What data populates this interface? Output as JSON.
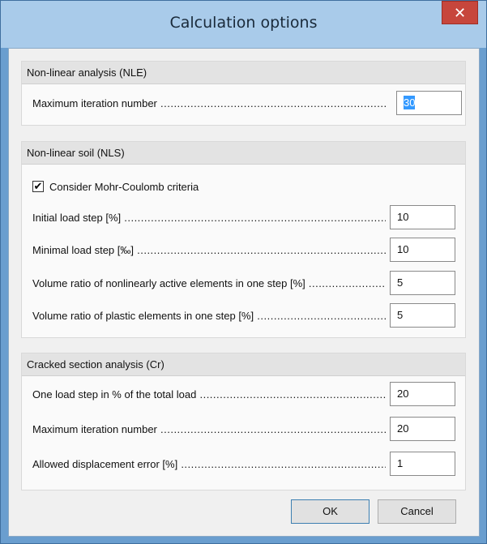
{
  "window": {
    "title": "Calculation options",
    "close_glyph": "✕"
  },
  "nle": {
    "header": "Non-linear analysis (NLE)",
    "rows": [
      {
        "label": "Maximum iteration number",
        "value": "30"
      }
    ]
  },
  "nls": {
    "header": "Non-linear soil (NLS)",
    "checkbox": {
      "label": "Consider Mohr-Coulomb criteria",
      "checked": true,
      "glyph": "✔"
    },
    "rows": [
      {
        "label": "Initial load step [%]",
        "value": "10"
      },
      {
        "label": "Minimal load step [‰]",
        "value": "10"
      },
      {
        "label": "Volume ratio of nonlinearly active elements in one step [%]",
        "value": "5"
      },
      {
        "label": "Volume ratio of plastic elements in one step [%]",
        "value": "5"
      }
    ]
  },
  "cr": {
    "header": "Cracked section analysis (Cr)",
    "rows": [
      {
        "label": "One load step in % of the total load",
        "value": "20"
      },
      {
        "label": "Maximum iteration number",
        "value": "20"
      },
      {
        "label": "Allowed displacement error [%]",
        "value": "1"
      }
    ]
  },
  "buttons": {
    "ok": "OK",
    "cancel": "Cancel"
  }
}
